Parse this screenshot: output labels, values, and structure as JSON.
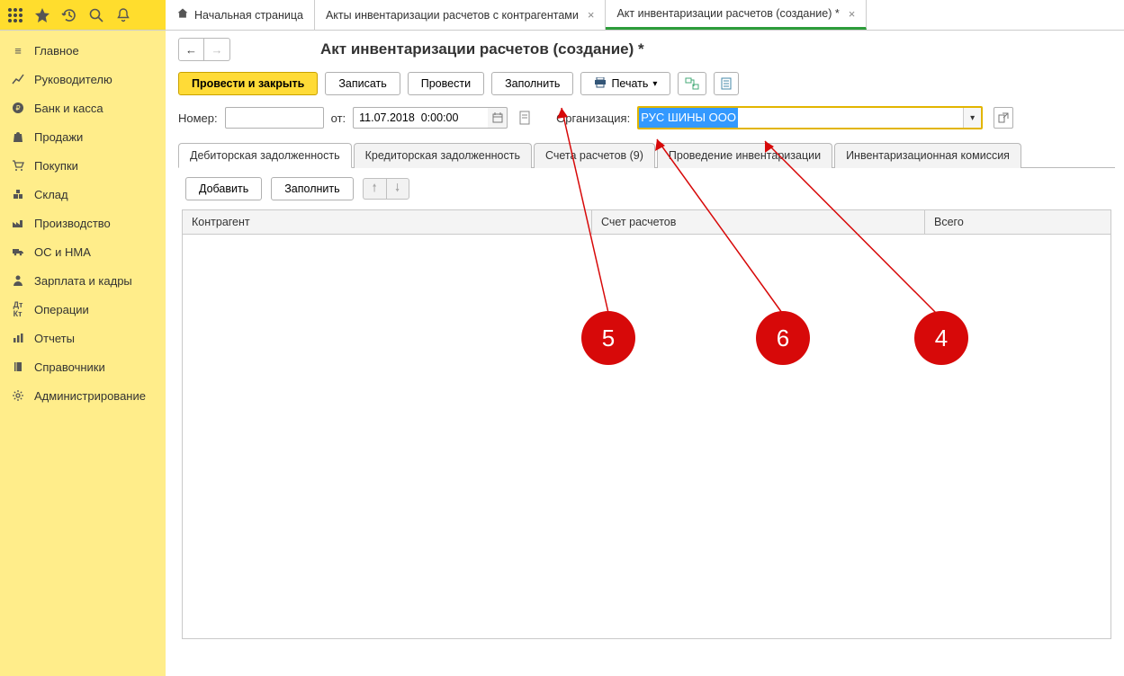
{
  "top_tabs": {
    "home": "Начальная страница",
    "tab1": "Акты инвентаризации расчетов с контрагентами",
    "tab2": "Акт инвентаризации расчетов (создание) *"
  },
  "sidebar": [
    {
      "icon": "menu",
      "label": "Главное"
    },
    {
      "icon": "trend",
      "label": "Руководителю"
    },
    {
      "icon": "ruble",
      "label": "Банк и касса"
    },
    {
      "icon": "bag",
      "label": "Продажи"
    },
    {
      "icon": "cart",
      "label": "Покупки"
    },
    {
      "icon": "boxes",
      "label": "Склад"
    },
    {
      "icon": "factory",
      "label": "Производство"
    },
    {
      "icon": "truck",
      "label": "ОС и НМА"
    },
    {
      "icon": "person",
      "label": "Зарплата и кадры"
    },
    {
      "icon": "dtkt",
      "label": "Операции"
    },
    {
      "icon": "bars",
      "label": "Отчеты"
    },
    {
      "icon": "book",
      "label": "Справочники"
    },
    {
      "icon": "gear",
      "label": "Администрирование"
    }
  ],
  "page_title": "Акт инвентаризации расчетов (создание) *",
  "toolbar": {
    "post_close": "Провести и закрыть",
    "save": "Записать",
    "post": "Провести",
    "fill": "Заполнить",
    "print": "Печать"
  },
  "form": {
    "number_label": "Номер:",
    "number_value": "",
    "from_label": "от:",
    "date_value": "11.07.2018  0:00:00",
    "org_label": "Организация:",
    "org_value": "РУС ШИНЫ ООО"
  },
  "subtabs": [
    "Дебиторская задолженность",
    "Кредиторская задолженность",
    "Счета расчетов (9)",
    "Проведение инвентаризации",
    "Инвентаризационная комиссия"
  ],
  "tab_toolbar": {
    "add": "Добавить",
    "fill": "Заполнить"
  },
  "columns": {
    "c1": "Контрагент",
    "c2": "Счет расчетов",
    "c3": "Всего"
  },
  "annotations": {
    "a5": "5",
    "a6": "6",
    "a4": "4"
  }
}
